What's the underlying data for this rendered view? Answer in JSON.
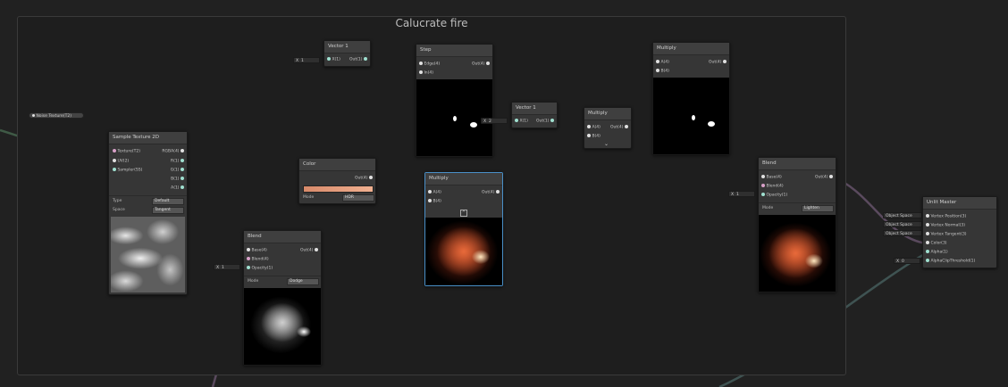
{
  "group": {
    "title": "Calucrate fire"
  },
  "nodes": {
    "noise": {
      "label": "Noise Texture(T2)"
    },
    "sample": {
      "title": "Sample Texture 2D",
      "in": [
        "Texture(T2)",
        "UV(2)",
        "Sampler(SS)"
      ],
      "out": [
        "RGBA(4)",
        "R(1)",
        "G(1)",
        "B(1)",
        "A(1)"
      ],
      "type_label": "Type",
      "type_value": "Default",
      "space_label": "Space",
      "space_value": "Tangent"
    },
    "vector1a": {
      "title": "Vector 1",
      "in": "X(1)",
      "out": "Out(1)",
      "x_label": "X",
      "x_value": "1"
    },
    "step": {
      "title": "Step",
      "in": [
        "Edge(4)",
        "In(4)"
      ],
      "out": "Out(4)"
    },
    "vector1b": {
      "title": "Vector 1",
      "in": "X(1)",
      "out": "Out(1)",
      "x_label": "X",
      "x_value": "2"
    },
    "multiply_small": {
      "title": "Multiply",
      "in": [
        "A(4)",
        "B(4)"
      ],
      "out": "Out(4)"
    },
    "multiply_top": {
      "title": "Multiply",
      "in": [
        "A(4)",
        "B(4)"
      ],
      "out": "Out(4)"
    },
    "color": {
      "title": "Color",
      "out": "Out(4)",
      "mode_label": "Mode",
      "mode_value": "HDR"
    },
    "multiply_mid": {
      "title": "Multiply",
      "in": [
        "A(4)",
        "B(4)"
      ],
      "out": "Out(4)"
    },
    "blend1": {
      "title": "Blend",
      "in": [
        "Base(4)",
        "Blend(4)",
        "Opacity(1)"
      ],
      "out": "Out(4)",
      "mode_label": "Mode",
      "mode_value": "Dodge",
      "opacity_x": "X",
      "opacity_value": "1"
    },
    "blend2": {
      "title": "Blend",
      "in": [
        "Base(4)",
        "Blend(4)",
        "Opacity(1)"
      ],
      "out": "Out(4)",
      "mode_label": "Mode",
      "mode_value": "Lighten",
      "opacity_x": "X",
      "opacity_value": "1"
    },
    "unlit": {
      "title": "Unlit Master",
      "in": [
        "Vertex Position(3)",
        "Vertex Normal(3)",
        "Vertex Tangent(3)",
        "Color(3)",
        "Alpha(1)",
        "AlphaClipThreshold(1)"
      ],
      "space_inputs": [
        "Object Space",
        "Object Space",
        "Object Space"
      ],
      "clip_x": "X",
      "clip_value": "0"
    }
  },
  "colors": {
    "wire": "#5a4a5e",
    "wire_green": "#3f5a46",
    "wire_teal": "#3f5352",
    "selection": "#4a90c8"
  }
}
